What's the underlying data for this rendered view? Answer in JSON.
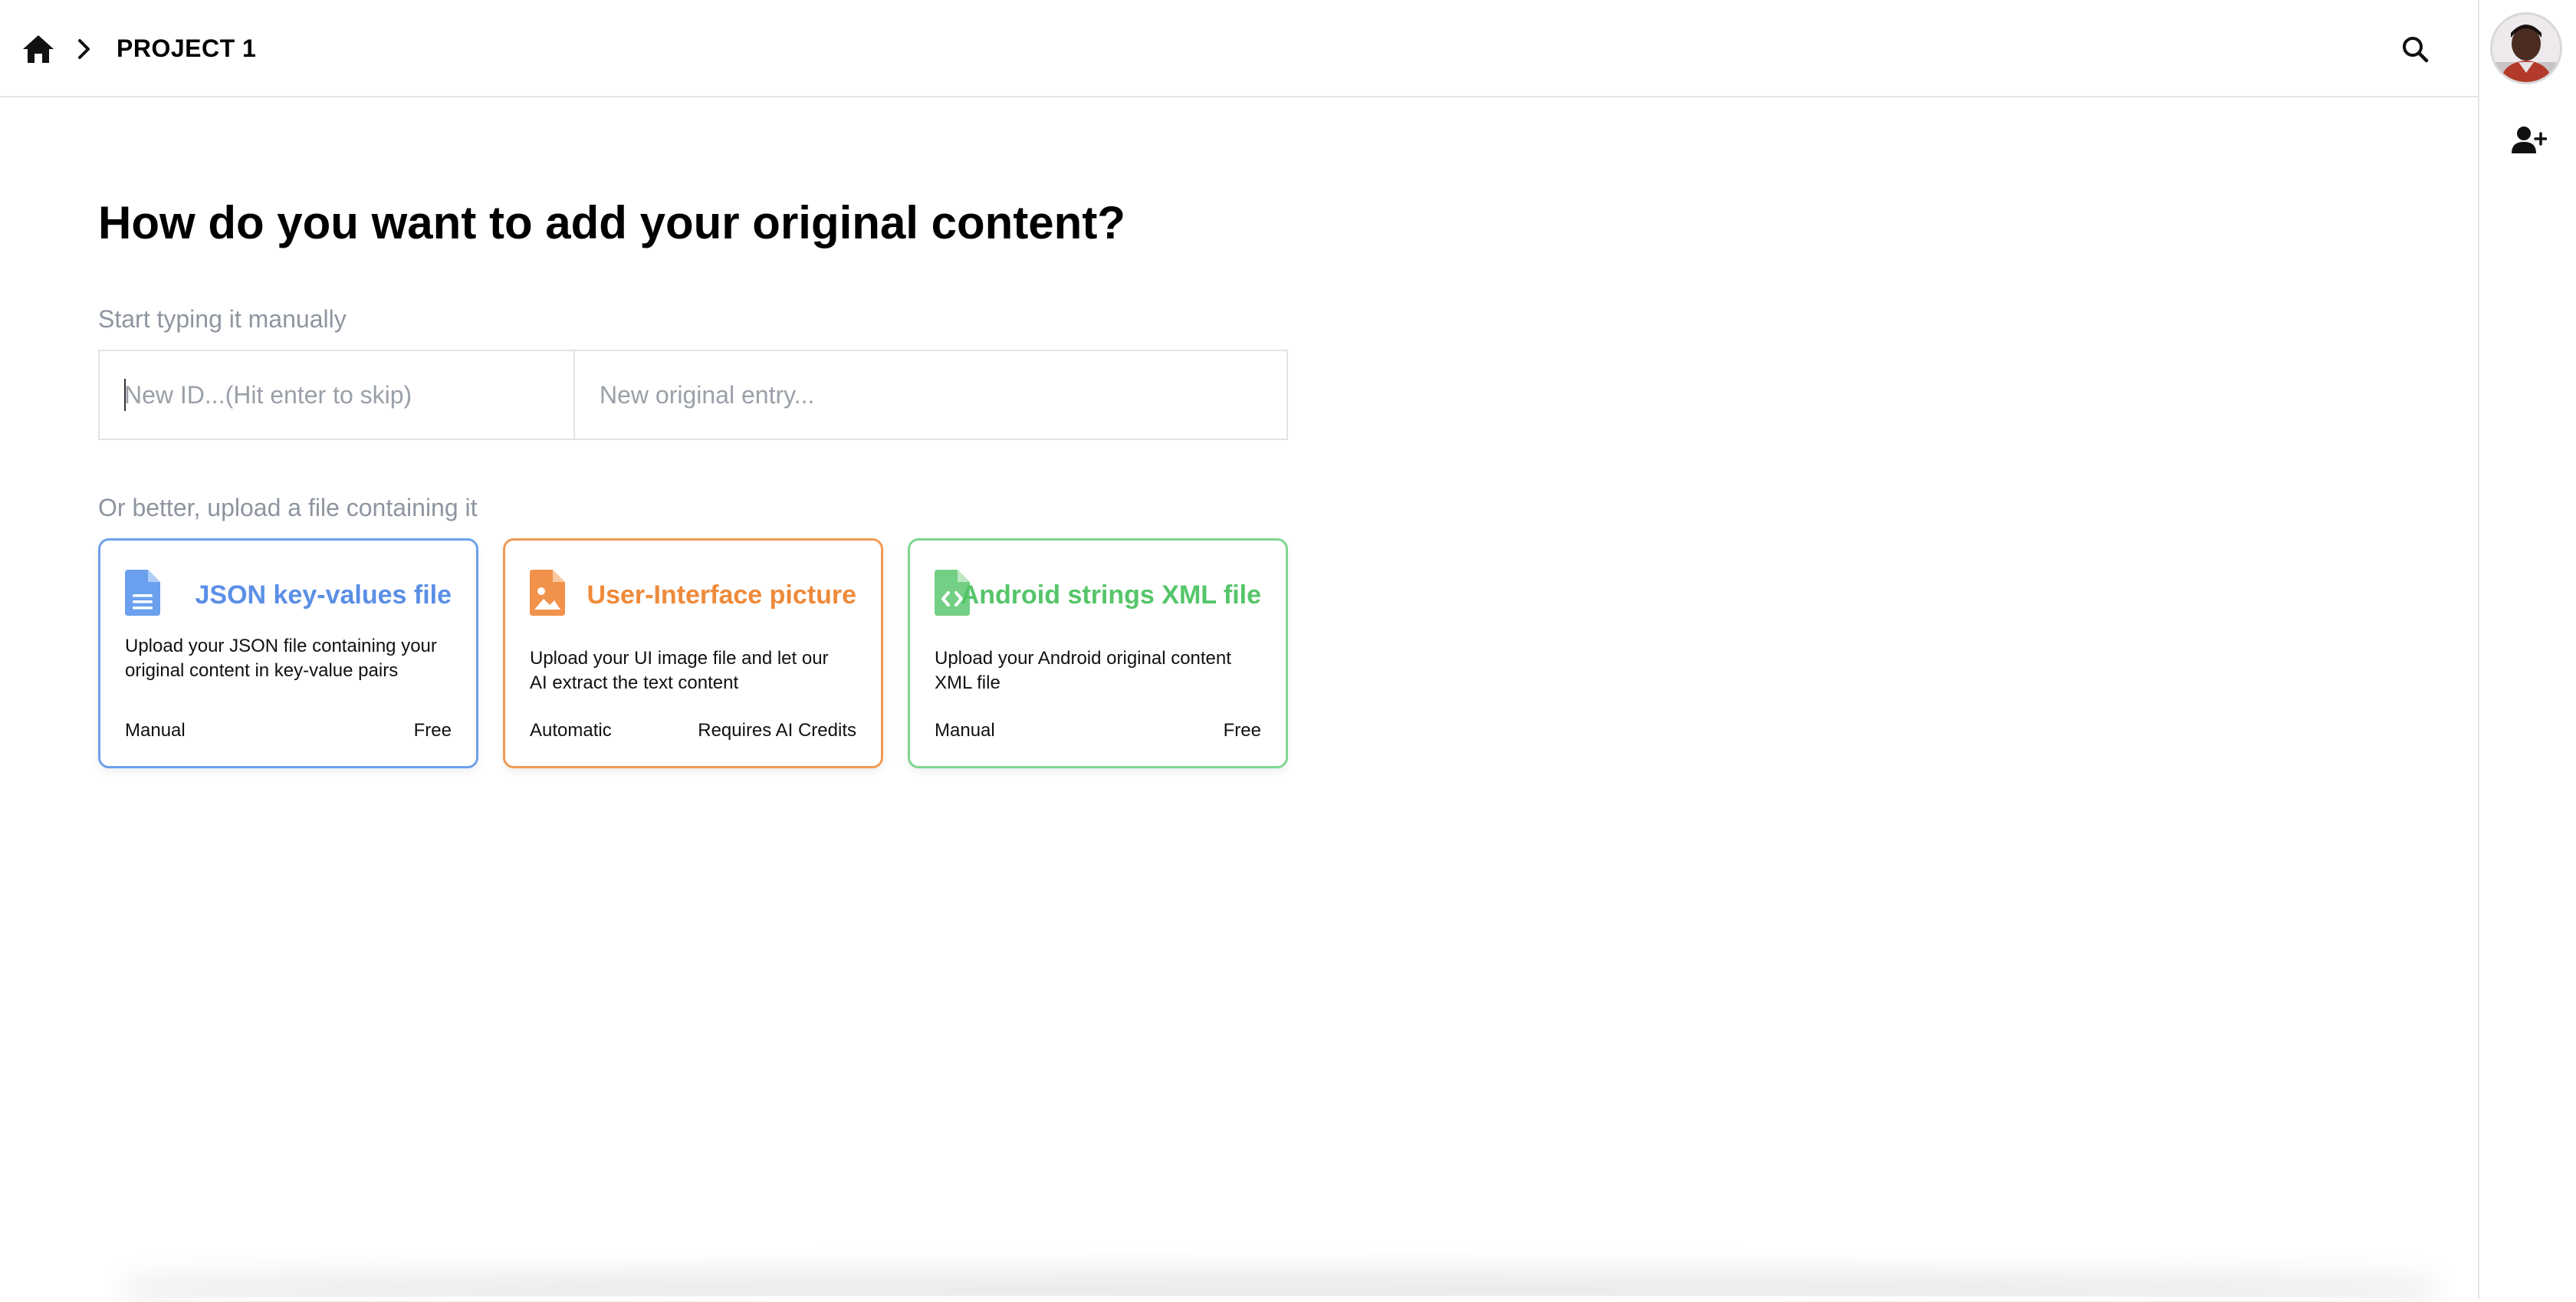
{
  "header": {
    "breadcrumb": {
      "home_icon": "home-icon",
      "separator_icon": "chevron-right-icon",
      "project_name": "PROJECT 1"
    },
    "search_icon": "search-icon"
  },
  "rightbar": {
    "avatar_icon": "avatar",
    "add_user_icon": "user-plus-icon"
  },
  "main": {
    "title": "How do you want to add your original content?",
    "manual_label": "Start typing it manually",
    "id_input": {
      "placeholder": "New ID...(Hit enter to skip)",
      "value": ""
    },
    "entry_input": {
      "placeholder": "New original entry...",
      "value": ""
    },
    "upload_label": "Or better, upload a file containing it",
    "cards": [
      {
        "icon": "document-icon",
        "title": "JSON key-values file",
        "description": "Upload your JSON file containing your original content in key-value pairs",
        "mode": "Manual",
        "cost": "Free",
        "color": "#5a8fe6"
      },
      {
        "icon": "image-file-icon",
        "title": "User-Interface picture",
        "description": "Upload your UI image file and let our AI extract the text content",
        "mode": "Automatic",
        "cost": "Requires AI Credits",
        "color": "#ee8a3a"
      },
      {
        "icon": "code-file-icon",
        "title": "Android strings XML file",
        "description": "Upload your Android original content XML file",
        "mode": "Manual",
        "cost": "Free",
        "color": "#56c56a"
      }
    ]
  }
}
